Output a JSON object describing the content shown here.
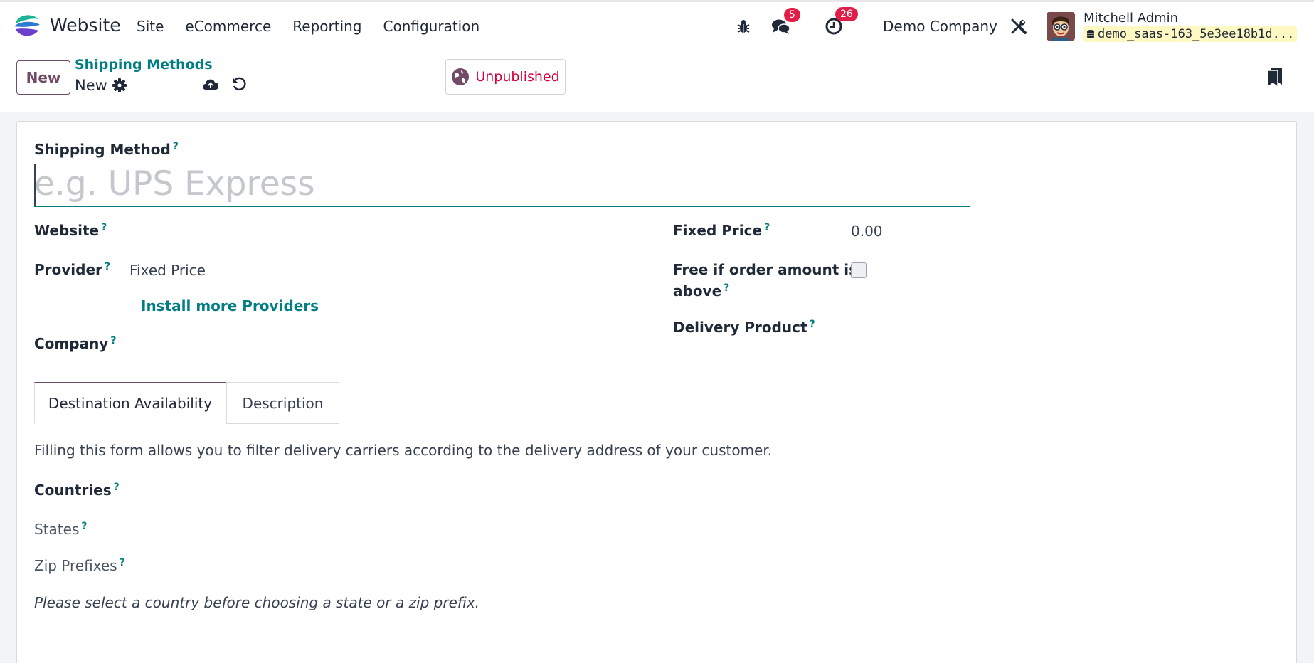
{
  "navbar": {
    "app_name": "Website",
    "menu": [
      "Site",
      "eCommerce",
      "Reporting",
      "Configuration"
    ],
    "messages_count": "5",
    "activities_count": "26",
    "company": "Demo Company",
    "user_name": "Mitchell Admin",
    "database": "demo_saas-163_5e3ee18b1d..."
  },
  "control": {
    "new_button": "New",
    "breadcrumb": "Shipping Methods",
    "record_name": "New",
    "publish_state": "Unpublished"
  },
  "form": {
    "name_label": "Shipping Method",
    "name_placeholder": "e.g. UPS Express",
    "help_mark": "?",
    "website_label": "Website",
    "provider_label": "Provider",
    "provider_value": "Fixed Price",
    "install_providers": "Install more Providers",
    "company_label": "Company",
    "fixed_price_label": "Fixed Price",
    "fixed_price_value": "0.00",
    "free_if_label_line1": "Free if order amount is",
    "free_if_label_line2": "above",
    "delivery_product_label": "Delivery Product"
  },
  "tabs": {
    "destination": "Destination Availability",
    "description": "Description"
  },
  "destination": {
    "intro": "Filling this form allows you to filter delivery carriers according to the delivery address of your customer.",
    "countries_label": "Countries",
    "states_label": "States",
    "zip_label": "Zip Prefixes",
    "note": "Please select a country before choosing a state or a zip prefix."
  },
  "colors": {
    "brand": "#714b67",
    "link": "#017e84",
    "badge": "#e11d48",
    "unpublished": "#d6003d"
  }
}
